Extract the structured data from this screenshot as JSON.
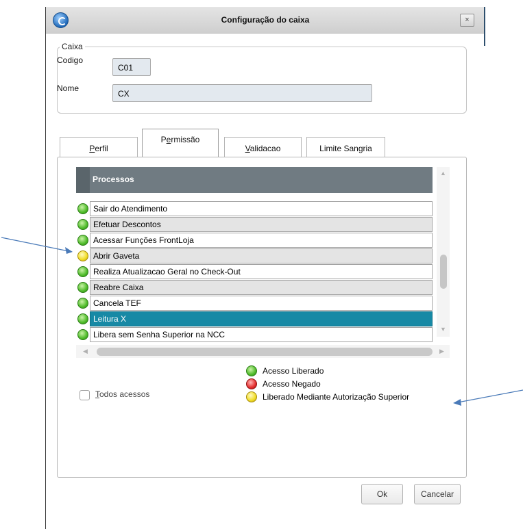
{
  "window": {
    "title": "Configuração do caixa",
    "close_label": "×"
  },
  "caixa": {
    "legend": "Caixa",
    "codigo_label": "Codigo",
    "codigo_value": "C01",
    "nome_label": "Nome",
    "nome_value": "CX"
  },
  "tabs": [
    {
      "label_hotkey": "P",
      "label_rest": "erfil"
    },
    {
      "label_pre": "P",
      "label_hotkey": "e",
      "label_rest": "rmissão"
    },
    {
      "label_hotkey": "V",
      "label_rest": "alidacao"
    },
    {
      "label": "Limite Sangria"
    }
  ],
  "grid": {
    "header": "Processos",
    "rows": [
      {
        "label": "Sair do Atendimento",
        "status": "green"
      },
      {
        "label": "Efetuar Descontos",
        "status": "green"
      },
      {
        "label": "Acessar Funções FrontLoja",
        "status": "green"
      },
      {
        "label": "Abrir Gaveta",
        "status": "yellow"
      },
      {
        "label": "Realiza Atualizacao Geral no Check-Out",
        "status": "green"
      },
      {
        "label": "Reabre Caixa",
        "status": "green"
      },
      {
        "label": "Cancela TEF",
        "status": "green"
      },
      {
        "label": "Leitura X",
        "status": "green",
        "selected": true
      },
      {
        "label": "Libera sem Senha Superior na NCC",
        "status": "green"
      }
    ]
  },
  "todos": {
    "hotkey": "T",
    "rest": "odos acessos"
  },
  "legend": {
    "liberado": "Acesso Liberado",
    "negado": "Acesso Negado",
    "autorizacao": "Liberado Mediante Autorização Superior"
  },
  "buttons": {
    "ok": "Ok",
    "cancelar": "Cancelar"
  },
  "colors": {
    "selected_row": "#1789a5",
    "grid_header": "#707b82",
    "annotation_arrow": "#4a7ab8"
  }
}
